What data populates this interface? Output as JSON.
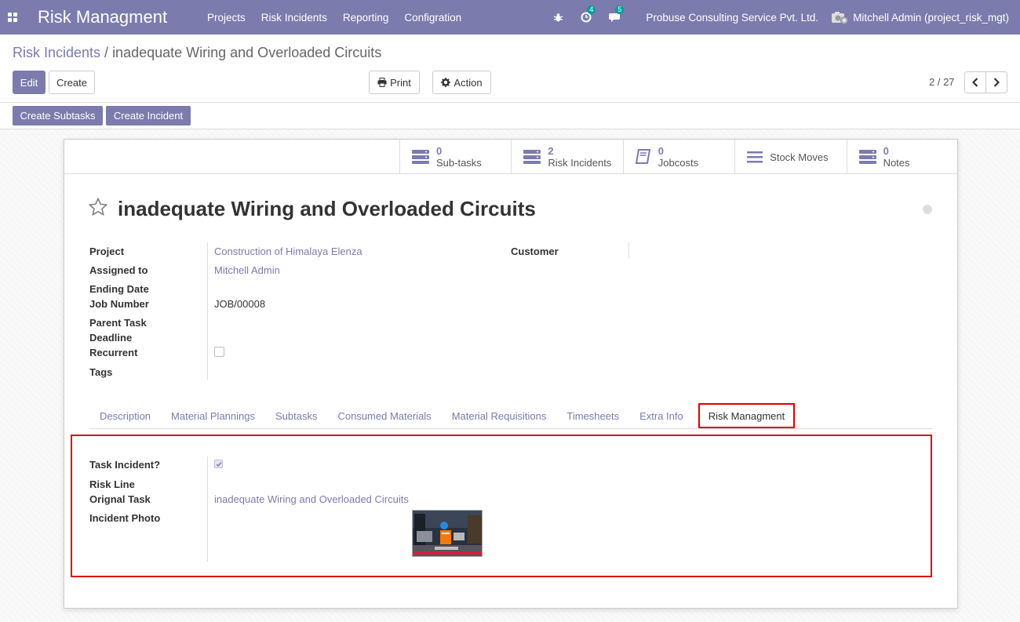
{
  "navbar": {
    "app_title": "Risk Managment",
    "menu": [
      "Projects",
      "Risk Incidents",
      "Reporting",
      "Configration"
    ],
    "activity_count": "4",
    "messages_count": "5",
    "company": "Probuse Consulting Service Pvt. Ltd.",
    "user": "Mitchell Admin (project_risk_mgt)"
  },
  "breadcrumb": {
    "parent": "Risk Incidents",
    "separator": " / ",
    "current": "inadequate Wiring and Overloaded Circuits"
  },
  "buttons": {
    "edit": "Edit",
    "create": "Create",
    "print": "Print",
    "action": "Action",
    "create_subtasks": "Create Subtasks",
    "create_incident": "Create Incident"
  },
  "pager": {
    "value": "2 / 27"
  },
  "stat_buttons": [
    {
      "value": "0",
      "label": "Sub-tasks"
    },
    {
      "value": "2",
      "label": "Risk Incidents"
    },
    {
      "value": "0",
      "label": "Jobcosts"
    },
    {
      "value": "",
      "label": "Stock Moves"
    },
    {
      "value": "0",
      "label": "Notes"
    }
  ],
  "record": {
    "title": "inadequate Wiring and Overloaded Circuits"
  },
  "fields": {
    "project_label": "Project",
    "project_value": "Construction of Himalaya Elenza",
    "customer_label": "Customer",
    "assigned_label": "Assigned to",
    "assigned_value": "Mitchell Admin",
    "ending_label": "Ending Date",
    "job_label": "Job Number",
    "job_value": "JOB/00008",
    "parent_label": "Parent Task",
    "deadline_label": "Deadline",
    "recurrent_label": "Recurrent",
    "tags_label": "Tags"
  },
  "tabs": [
    "Description",
    "Material Plannings",
    "Subtasks",
    "Consumed Materials",
    "Material Requisitions",
    "Timesheets",
    "Extra Info",
    "Risk Managment"
  ],
  "risk_tab": {
    "task_incident_label": "Task Incident?",
    "task_incident_checked": true,
    "risk_line_label": "Risk Line",
    "orignal_task_label": "Orignal Task",
    "orignal_task_value": "inadequate Wiring and Overloaded Circuits",
    "incident_photo_label": "Incident Photo"
  },
  "colors": {
    "brand": "#7c7bad",
    "highlight": "#dd0000",
    "badge": "#00a09d"
  }
}
